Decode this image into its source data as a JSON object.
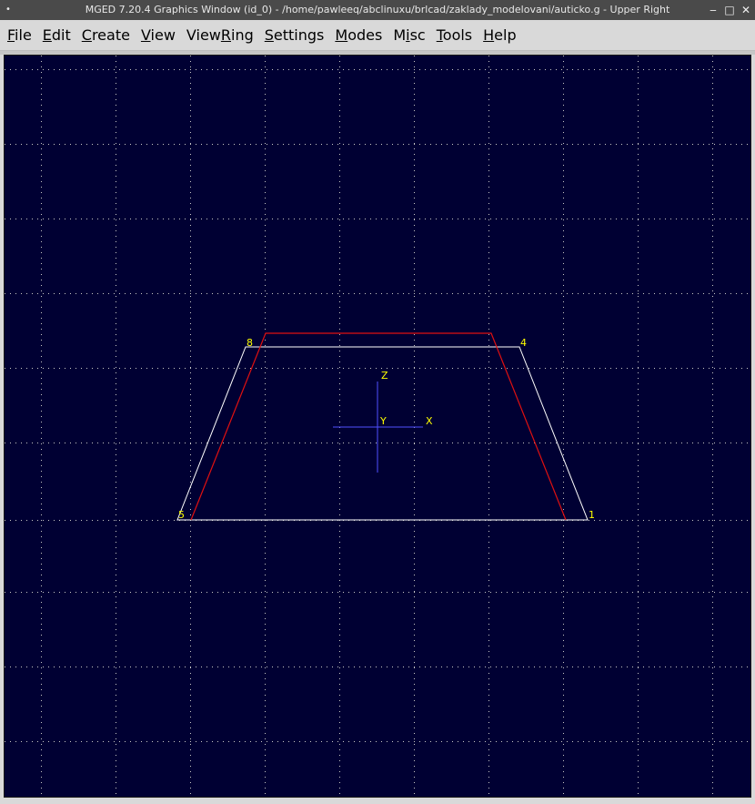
{
  "window": {
    "title": "MGED 7.20.4 Graphics Window (id_0) - /home/pawleeq/abclinuxu/brlcad/zaklady_modelovani/auticko.g - Upper Right",
    "menu_glyph": "•",
    "minimize_glyph": "‒",
    "maximize_glyph": "□",
    "close_glyph": "✕"
  },
  "menubar": {
    "items": [
      {
        "u": "F",
        "rest": "ile"
      },
      {
        "u": "E",
        "rest": "dit"
      },
      {
        "u": "C",
        "rest": "reate"
      },
      {
        "u": "V",
        "rest": "iew"
      },
      {
        "pre": "View",
        "u": "R",
        "rest": "ing"
      },
      {
        "u": "S",
        "rest": "ettings"
      },
      {
        "u": "M",
        "rest": "odes"
      },
      {
        "pre": "M",
        "u": "i",
        "rest": "sc"
      },
      {
        "u": "T",
        "rest": "ools"
      },
      {
        "u": "H",
        "rest": "elp"
      }
    ]
  },
  "viewport": {
    "background": "#000033",
    "grid_color": "#c8c8c8",
    "white_line_color": "#ffffff",
    "red_line_color": "#e01010",
    "axis_color": "#5050ff",
    "label_color": "#ffff00",
    "vertex_labels": {
      "top_left": "8",
      "top_right": "4",
      "bottom_left": "5",
      "bottom_right": "1"
    },
    "axis_labels": {
      "z": "Z",
      "y": "Y",
      "x": "X"
    }
  }
}
